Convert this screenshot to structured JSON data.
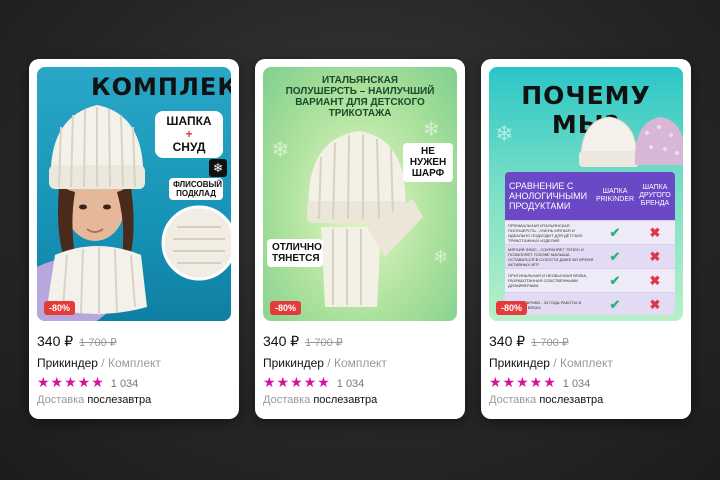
{
  "cards": [
    {
      "image": {
        "title": "КОМПЛЕКТ",
        "bubble": [
          "ШАПКА",
          "+",
          "СНУД"
        ],
        "badge": "ФЛИСОВЫЙ ПОДКЛАД"
      },
      "discount": "-80%",
      "price": "340 ₽",
      "old_price": "1 700 ₽",
      "brand": "Прикиндер",
      "category": "/ Комплект",
      "rating": 5,
      "reviews": "1 034",
      "delivery_label": "Доставка",
      "delivery_value": "послезавтра"
    },
    {
      "image": {
        "title": "ИТАЛЬЯНСКАЯ ПОЛУШЕРСТЬ – НАИЛУЧШИЙ ВАРИАНТ ДЛЯ ДЕТСКОГО ТРИКОТАЖА",
        "sticker1": "НЕ НУЖЕН ШАРФ",
        "sticker2": "ОТЛИЧНО ТЯНЕТСЯ"
      },
      "discount": "-80%",
      "price": "340 ₽",
      "old_price": "1 700 ₽",
      "brand": "Прикиндер",
      "category": "/ Комплект",
      "rating": 5,
      "reviews": "1 034",
      "delivery_label": "Доставка",
      "delivery_value": "послезавтра"
    },
    {
      "image": {
        "title": "ПОЧЕМУ МЫ?",
        "table_head": "СРАВНЕНИЕ С АНОЛОГИЧНЫМИ ПРОДУКТАМИ",
        "col1": "ШАПКА PRIKINDER",
        "col2": "ШАПКА ДРУГОГО БРЕНДА",
        "rows": [
          "ПРЕМИАЛЬНАЯ ИТАЛЬЯНСКАЯ ПОЛУШЕРСТЬ - ОЧЕНЬ МЯГКАЯ И ИДЕАЛЬНО ПОДХОДИТ ДЛЯ ДЕТСКИХ ТРИКОТАЖНЫХ ИЗДЕЛИЙ.",
          "МЯГКИЙ ФЛИС - СОХРАНЯЕТ ТЕПЛО И ПОЗВОЛЯЕТ ГОЛОВЕ МАЛЫША ОСТАВАТЬСЯ В СУХОСТИ ДАЖЕ ВО ВРЕМЯ АКТИВНЫХ ИГР.",
          "ОРИГИНАЛЬНАЯ И НЕОБЫЧНАЯ ВЯЗКА, РАЗРАБОТАННАЯ СОБСТВЕННЫМИ ДИЗАЙНЕРАМИ",
          "ОПЫТ ФАБРИКИ - 33 ГОДА РАБОТЫ В ДЕТСКИХ ВЯЗАХ"
        ],
        "check": "✔",
        "cross": "✖"
      },
      "discount": "-80%",
      "price": "340 ₽",
      "old_price": "1 700 ₽",
      "brand": "Прикиндер",
      "category": "/ Комплект",
      "rating": 5,
      "reviews": "1 034",
      "delivery_label": "Доставка",
      "delivery_value": "послезавтра"
    }
  ],
  "star_glyphs": "★★★★★",
  "snow_glyph": "❄",
  "colors": {
    "accent_star": "#d6119d",
    "discount": "#e43a3a",
    "table_head": "#6b48c5"
  }
}
